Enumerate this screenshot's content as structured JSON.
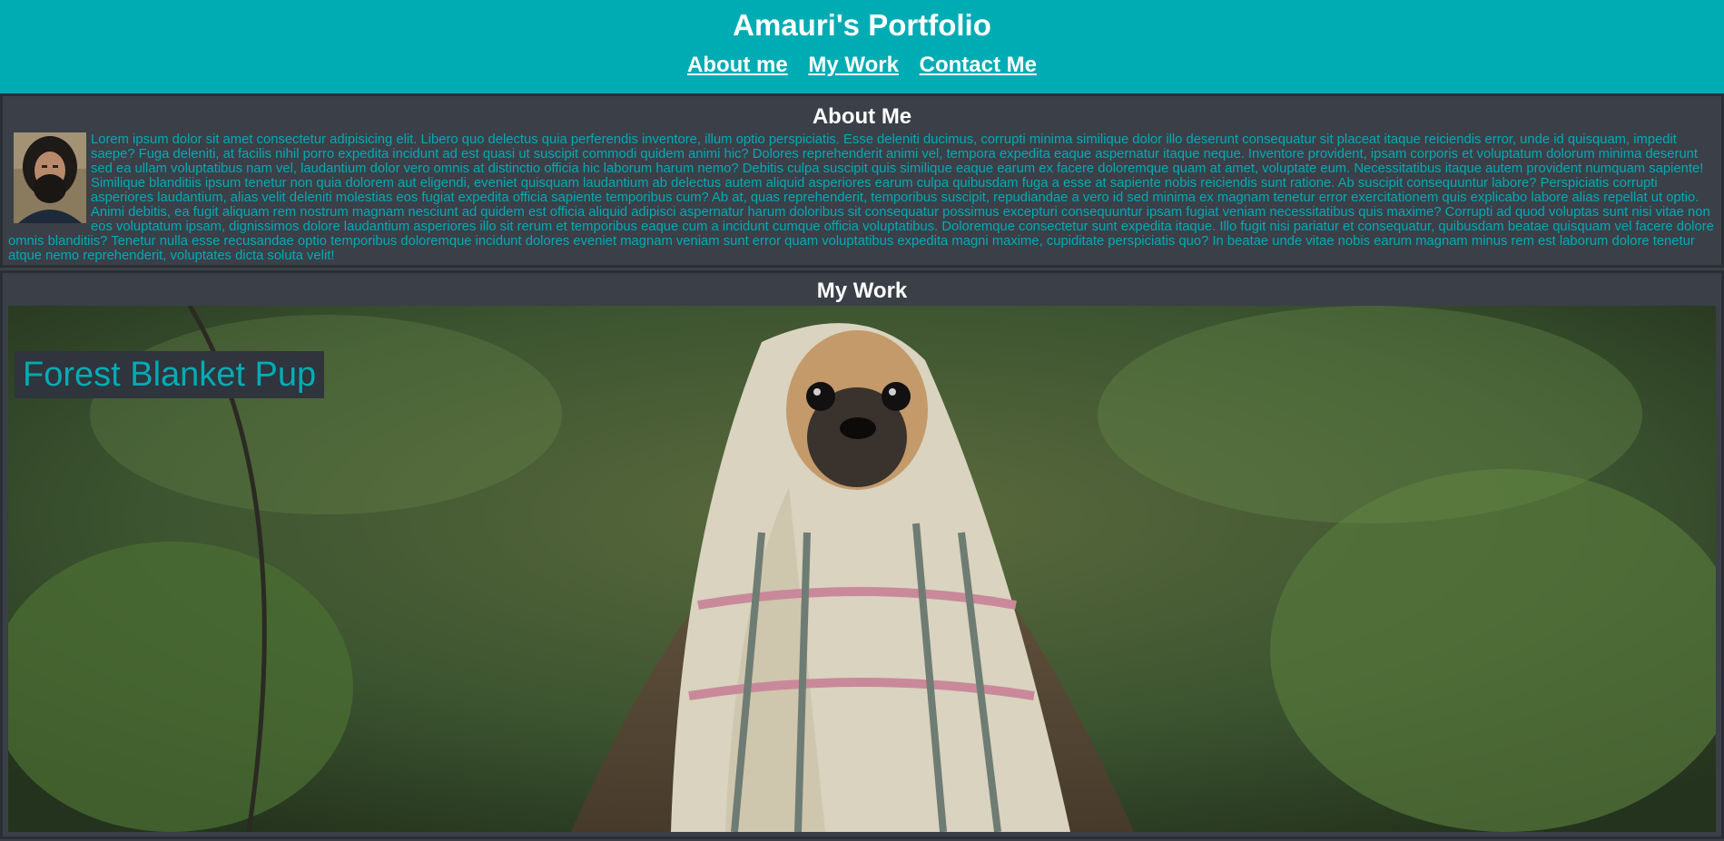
{
  "header": {
    "title": "Amauri's Portfolio",
    "nav": [
      "About me",
      "My Work",
      "Contact Me"
    ]
  },
  "about": {
    "heading": "About Me",
    "text": "Lorem ipsum dolor sit amet consectetur adipisicing elit. Libero quo delectus quia perferendis inventore, illum optio perspiciatis. Esse deleniti ducimus, corrupti minima similique dolor illo deserunt consequatur sit placeat itaque reiciendis error, unde id quisquam, impedit saepe? Fuga deleniti, at facilis nihil porro expedita incidunt ad est quasi ut suscipit commodi quidem animi hic? Dolores reprehenderit animi vel, tempora expedita eaque aspernatur itaque neque. Inventore provident, ipsam corporis et voluptatum dolorum minima deserunt sed ea ullam voluptatibus nam vel, laudantium dolor vero omnis at distinctio officia hic laborum harum nemo? Debitis culpa suscipit quis similique eaque earum ex facere doloremque quam at amet, voluptate eum. Necessitatibus itaque autem provident numquam sapiente! Similique blanditiis ipsum tenetur non quia dolorem aut eligendi, eveniet quisquam laudantium ab delectus autem aliquid asperiores earum culpa quibusdam fuga a esse at sapiente nobis reiciendis sunt ratione. Ab suscipit consequuntur labore? Perspiciatis corrupti asperiores laudantium, alias velit deleniti molestias eos fugiat expedita officia sapiente temporibus cum? Ab at, quas reprehenderit, temporibus suscipit, repudiandae a vero id sed minima ex magnam tenetur error exercitationem quis explicabo labore alias repellat ut optio. Animi debitis, ea fugit aliquam rem nostrum magnam nesciunt ad quidem est officia aliquid adipisci aspernatur harum doloribus sit consequatur possimus excepturi consequuntur ipsam fugiat veniam necessitatibus quis maxime? Corrupti ad quod voluptas sunt nisi vitae non eos voluptatum ipsam, dignissimos dolore laudantium asperiores illo sit rerum et temporibus eaque cum a incidunt cumque officia voluptatibus. Doloremque consectetur sunt expedita itaque. Illo fugit nisi pariatur et consequatur, quibusdam beatae quisquam vel facere dolore omnis blanditiis? Tenetur nulla esse recusandae optio temporibus doloremque incidunt dolores eveniet magnam veniam sunt error quam voluptatibus expedita magni maxime, cupiditate perspiciatis quo? In beatae unde vitae nobis earum magnam minus rem est laborum dolore tenetur atque nemo reprehenderit, voluptates dicta soluta velit!"
  },
  "work": {
    "heading": "My Work",
    "project_caption": "Forest Blanket Pup"
  },
  "colors": {
    "accent": "#00acb4",
    "background": "#3b3f48",
    "border": "#2b2e35",
    "text_light": "#ffffff"
  }
}
